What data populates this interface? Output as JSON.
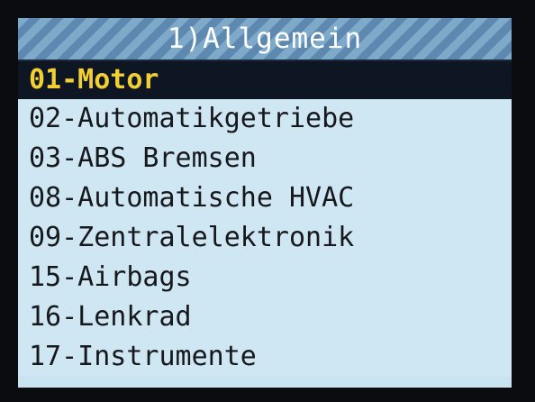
{
  "title": "1)Allgemein",
  "colors": {
    "screen_background": "#c9e3f1",
    "title_stripe_light": "#7fa9c9",
    "title_stripe_dark": "#5d89b0",
    "selected_background": "#0d1622",
    "selected_text": "#f2cf33",
    "item_text": "#16181c"
  },
  "menu": {
    "selected_index": 0,
    "items": [
      {
        "label": "01-Motor"
      },
      {
        "label": "02-Automatikgetriebe"
      },
      {
        "label": "03-ABS Bremsen"
      },
      {
        "label": "08-Automatische HVAC"
      },
      {
        "label": "09-Zentralelektronik"
      },
      {
        "label": "15-Airbags"
      },
      {
        "label": "16-Lenkrad"
      },
      {
        "label": "17-Instrumente"
      }
    ]
  }
}
